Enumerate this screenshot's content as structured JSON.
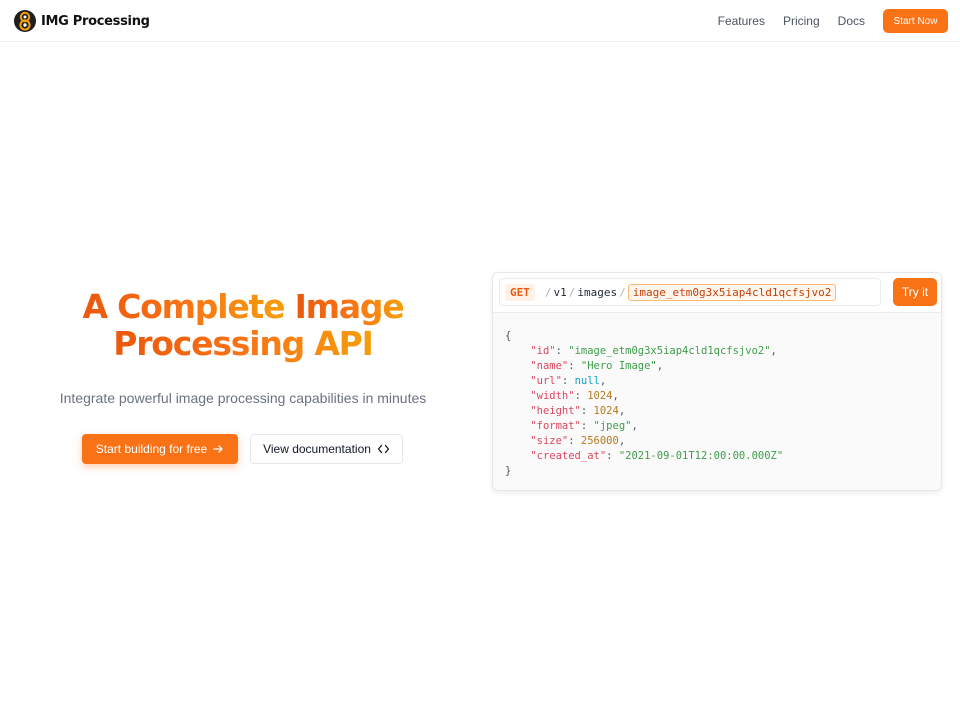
{
  "brand": {
    "name": "IMG Processing",
    "logo_icon": "spiral-8-logo-icon"
  },
  "nav": {
    "links": [
      "Features",
      "Pricing",
      "Docs"
    ],
    "cta_label": "Start Now"
  },
  "hero": {
    "title_part1": "A Complete",
    "title_part2": "Image",
    "title_line2": "Processing API",
    "subtitle": "Integrate powerful image processing capabilities in minutes",
    "primary_cta": "Start building for free",
    "secondary_cta": "View documentation"
  },
  "api_panel": {
    "method": "GET",
    "path": [
      "v1",
      "images"
    ],
    "image_id": "image_etm0g3x5iap4cld1qcfsjvo2",
    "try_label": "Try it",
    "response": {
      "open_brace": "{",
      "close_brace": "}",
      "fields": [
        {
          "key": "\"id\"",
          "value": "\"image_etm0g3x5iap4cld1qcfsjvo2\"",
          "type": "string"
        },
        {
          "key": "\"name\"",
          "value": "\"Hero Image\"",
          "type": "string"
        },
        {
          "key": "\"url\"",
          "value": "null",
          "type": "null"
        },
        {
          "key": "\"width\"",
          "value": "1024",
          "type": "number"
        },
        {
          "key": "\"height\"",
          "value": "1024",
          "type": "number"
        },
        {
          "key": "\"format\"",
          "value": "\"jpeg\"",
          "type": "string"
        },
        {
          "key": "\"size\"",
          "value": "256000",
          "type": "number"
        },
        {
          "key": "\"created_at\"",
          "value": "\"2021-09-01T12:00:00.000Z\"",
          "type": "string"
        }
      ]
    }
  },
  "colors": {
    "accent": "#f97316",
    "accent_dark": "#ea580c",
    "accent_amber": "#f59e0b"
  }
}
